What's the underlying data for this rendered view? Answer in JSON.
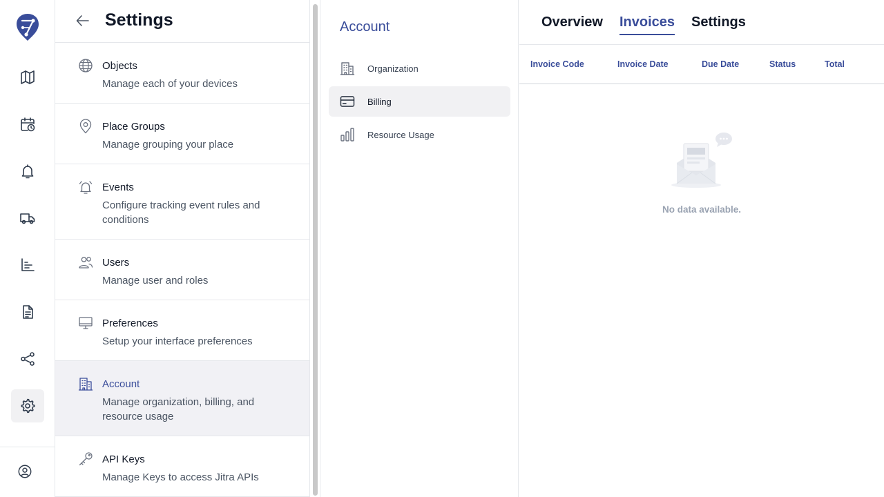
{
  "app": {
    "logo": "jitra-logo",
    "accent_color": "#3a4d9a"
  },
  "rail": {
    "items": [
      {
        "icon": "map-icon"
      },
      {
        "icon": "calendar-clock-icon"
      },
      {
        "icon": "bell-icon"
      },
      {
        "icon": "truck-icon"
      },
      {
        "icon": "bar-chart-icon"
      },
      {
        "icon": "document-icon"
      },
      {
        "icon": "share-icon"
      },
      {
        "icon": "gear-icon",
        "active": true
      }
    ],
    "profile_icon": "user-circle-icon"
  },
  "settings": {
    "title": "Settings",
    "items": [
      {
        "name": "Objects",
        "description": "Manage each of your devices",
        "icon": "globe-icon"
      },
      {
        "name": "Place Groups",
        "description": "Manage grouping your place",
        "icon": "map-pin-icon"
      },
      {
        "name": "Events",
        "description": "Configure tracking event rules and conditions",
        "icon": "alarm-bell-icon"
      },
      {
        "name": "Users",
        "description": "Manage user and roles",
        "icon": "users-icon"
      },
      {
        "name": "Preferences",
        "description": "Setup your interface preferences",
        "icon": "monitor-icon"
      },
      {
        "name": "Account",
        "description": "Manage organization, billing, and resource usage",
        "icon": "building-icon",
        "active": true
      },
      {
        "name": "API Keys",
        "description": "Manage Keys to access Jitra APIs",
        "icon": "key-icon"
      }
    ]
  },
  "account": {
    "title": "Account",
    "items": [
      {
        "label": "Organization",
        "icon": "building-icon"
      },
      {
        "label": "Billing",
        "icon": "credit-card-icon",
        "active": true
      },
      {
        "label": "Resource Usage",
        "icon": "bar-chart-icon"
      }
    ]
  },
  "content": {
    "tabs": [
      {
        "label": "Overview"
      },
      {
        "label": "Invoices",
        "active": true
      },
      {
        "label": "Settings"
      }
    ],
    "columns": [
      "Invoice Code",
      "Invoice Date",
      "Due Date",
      "Status",
      "Total"
    ],
    "empty_text": "No data available."
  }
}
